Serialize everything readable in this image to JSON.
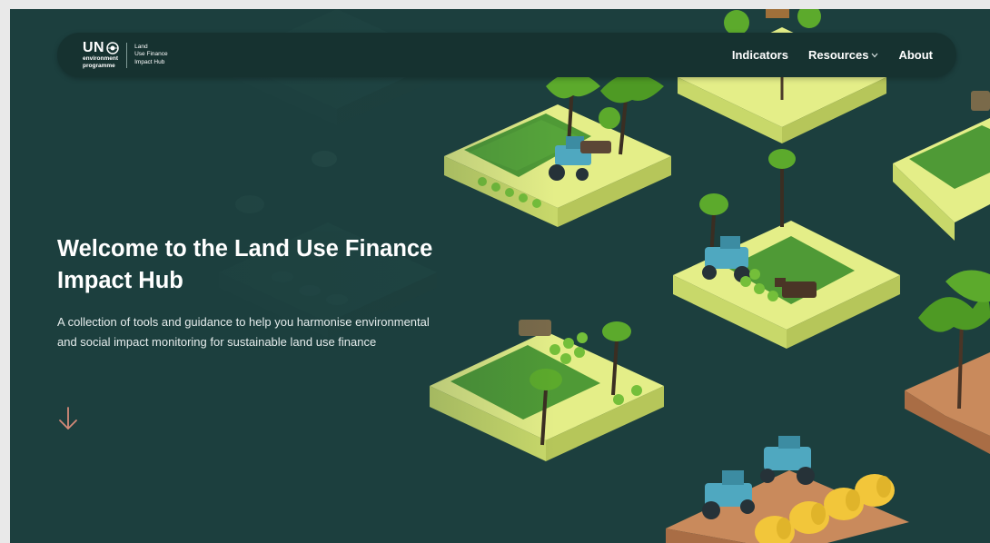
{
  "logo": {
    "un": "UN",
    "environment": "environment",
    "programme": "programme",
    "hub_line1": "Land",
    "hub_line2": "Use Finance",
    "hub_line3": "Impact Hub"
  },
  "nav": {
    "items": [
      {
        "label": "Indicators"
      },
      {
        "label": "Resources"
      },
      {
        "label": "About"
      }
    ]
  },
  "hero": {
    "title": "Welcome to the Land Use Finance Impact Hub",
    "description": "A collection of tools and guidance to help you harmonise environmental and social impact monitoring for sustainable land use finance"
  },
  "icons": {
    "un_emblem": "un-emblem-icon",
    "resources_dropdown": "chevron-down-icon",
    "scroll_down": "arrow-down-icon"
  },
  "colors": {
    "background": "#1c3f3e",
    "navbar": "#163230",
    "text": "#ffffff",
    "arrow": "#d48a78",
    "tile_top": "#e4ee88",
    "tile_side": "#c8d86a",
    "grass": "#4f9a36",
    "soil": "#c98a5c",
    "tractor": "#4fa8c0",
    "hay": "#f2c63a"
  }
}
